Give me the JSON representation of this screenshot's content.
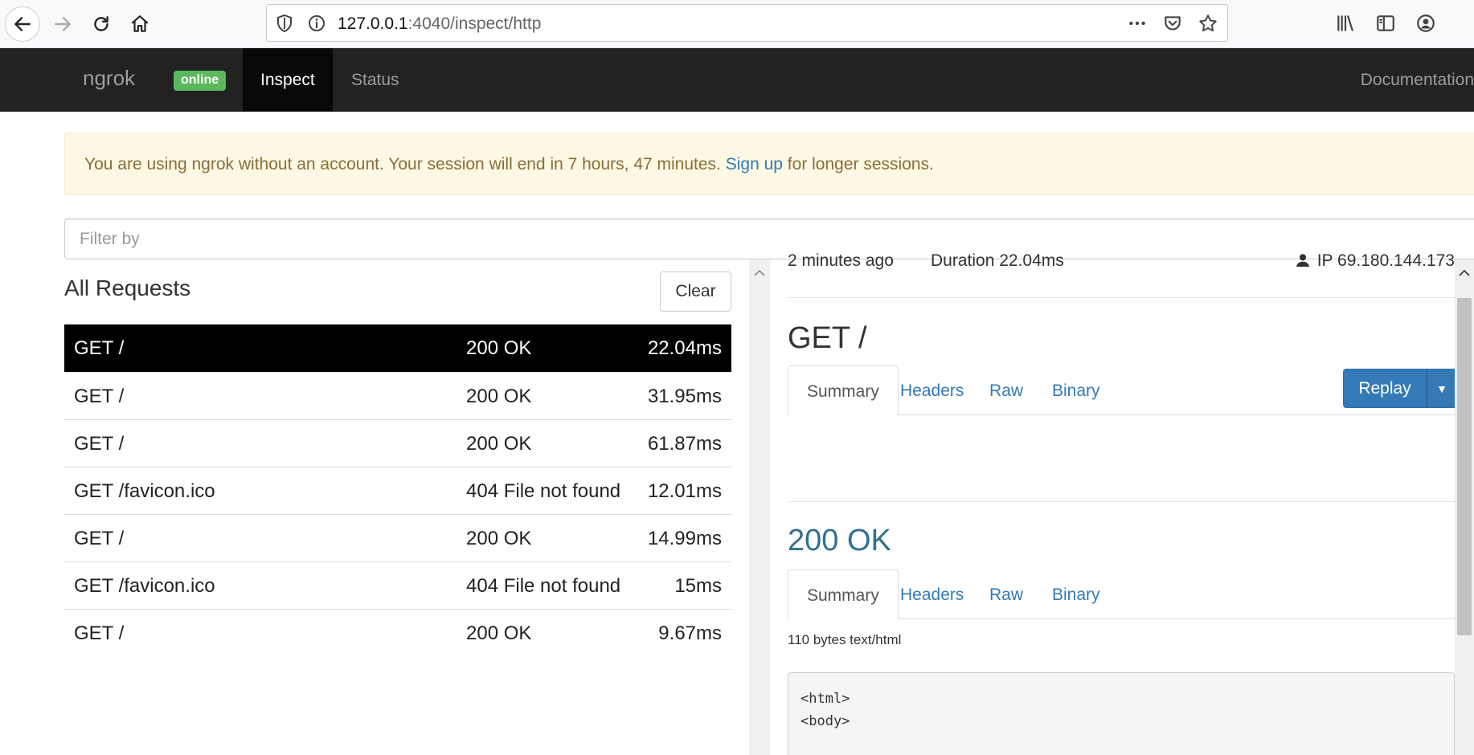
{
  "browser": {
    "url_host": "127.0.0.1",
    "url_rest": ":4040/inspect/http",
    "icons": [
      "back-arrow-icon",
      "forward-arrow-icon",
      "reload-icon",
      "home-icon",
      "shield-icon",
      "info-icon",
      "more-icon",
      "pocket-icon",
      "star-icon",
      "library-icon",
      "sidebar-icon",
      "account-icon"
    ]
  },
  "navbar": {
    "brand": "ngrok",
    "status_badge": "online",
    "tabs": [
      "Inspect",
      "Status"
    ],
    "documentation": "Documentation"
  },
  "alert": {
    "text_before": "You are using ngrok without an account. Your session will end in 7 hours, 47 minutes. ",
    "link": "Sign up",
    "text_after": " for longer sessions."
  },
  "filter": {
    "placeholder": "Filter by"
  },
  "requests": {
    "title": "All Requests",
    "clear_label": "Clear",
    "rows": [
      {
        "path": "GET /",
        "status": "200 OK",
        "duration": "22.04ms"
      },
      {
        "path": "GET /",
        "status": "200 OK",
        "duration": "31.95ms"
      },
      {
        "path": "GET /",
        "status": "200 OK",
        "duration": "61.87ms"
      },
      {
        "path": "GET /favicon.ico",
        "status": "404 File not found",
        "duration": "12.01ms"
      },
      {
        "path": "GET /",
        "status": "200 OK",
        "duration": "14.99ms"
      },
      {
        "path": "GET /favicon.ico",
        "status": "404 File not found",
        "duration": "15ms"
      },
      {
        "path": "GET /",
        "status": "200 OK",
        "duration": "9.67ms"
      }
    ]
  },
  "detail": {
    "time_ago": "2 minutes ago",
    "duration": "Duration  22.04ms",
    "ip": "IP  69.180.144.173",
    "request_title": "GET /",
    "request_tabs": [
      "Summary",
      "Headers",
      "Raw",
      "Binary"
    ],
    "replay_label": "Replay",
    "response_status": "200 OK",
    "response_tabs": [
      "Summary",
      "Headers",
      "Raw",
      "Binary"
    ],
    "response_meta": "110 bytes text/html",
    "code_lines": [
      "<html>",
      "",
      "<body>"
    ]
  }
}
